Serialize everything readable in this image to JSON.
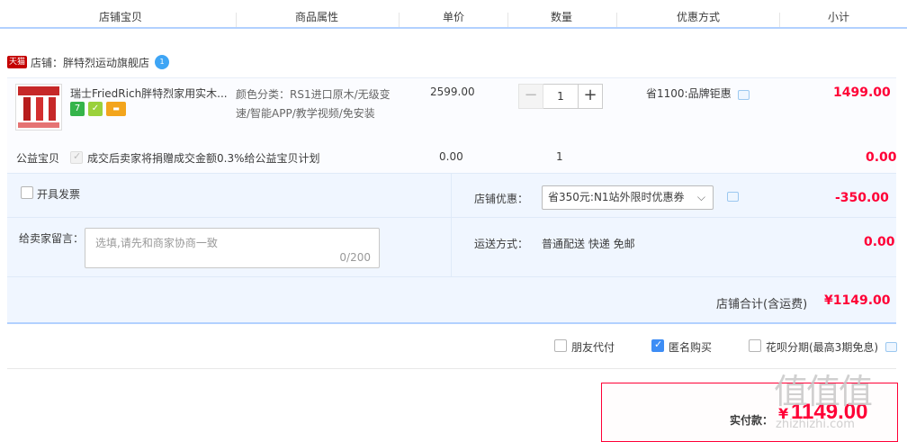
{
  "header": {
    "columns": [
      "店铺宝贝",
      "商品属性",
      "单价",
      "数量",
      "优惠方式",
      "小计"
    ]
  },
  "shop": {
    "tag": "天猫",
    "label": "店铺：",
    "name": "胖特烈运动旗舰店",
    "chat_badge": "1"
  },
  "item": {
    "title": "瑞士FriedRich胖特烈家用实木...",
    "attr": "颜色分类：RS1进口原木/无级变速/智能APP/教学视频/免安装",
    "price": "2599.00",
    "qty": "1",
    "qty_minus": "−",
    "qty_plus": "+",
    "promo": "省1100:品牌钜惠",
    "subtotal": "1499.00",
    "badges": [
      {
        "text": "7",
        "color": "#35b44a"
      },
      {
        "text": "✓",
        "color": "#9ad13b"
      },
      {
        "text": "▬",
        "color": "#f3a51c"
      }
    ]
  },
  "charity": {
    "label": "公益宝贝",
    "desc": "成交后卖家将捐赠成交金额0.3%给公益宝贝计划",
    "price": "0.00",
    "qty": "1",
    "subtotal": "0.00"
  },
  "invoice": {
    "label": "开具发票"
  },
  "shop_discount": {
    "label": "店铺优惠：",
    "selected": "省350元:N1站外限时优惠券",
    "amount": "-350.00"
  },
  "message": {
    "label": "给卖家留言：",
    "placeholder": "选填,请先和商家协商一致",
    "counter": "0/200"
  },
  "shipping": {
    "label": "运送方式：",
    "method": "普通配送 快递 免邮",
    "amount": "0.00"
  },
  "shop_total": {
    "label": "店铺合计(含运费)",
    "amount": "¥1149.00"
  },
  "options": {
    "friend_pay": "朋友代付",
    "anonymous": "匿名购买",
    "huabei": "花呗分期(最高3期免息)"
  },
  "payment": {
    "label": "实付款：",
    "currency": "¥",
    "amount": "1149.00"
  },
  "watermark": {
    "text": "值值值",
    "url": "zhizhizhi.com"
  },
  "colors": {
    "accent_red": "#ff0036",
    "accent_blue": "#3d8df5",
    "panel_bg": "#f0f6ff"
  }
}
